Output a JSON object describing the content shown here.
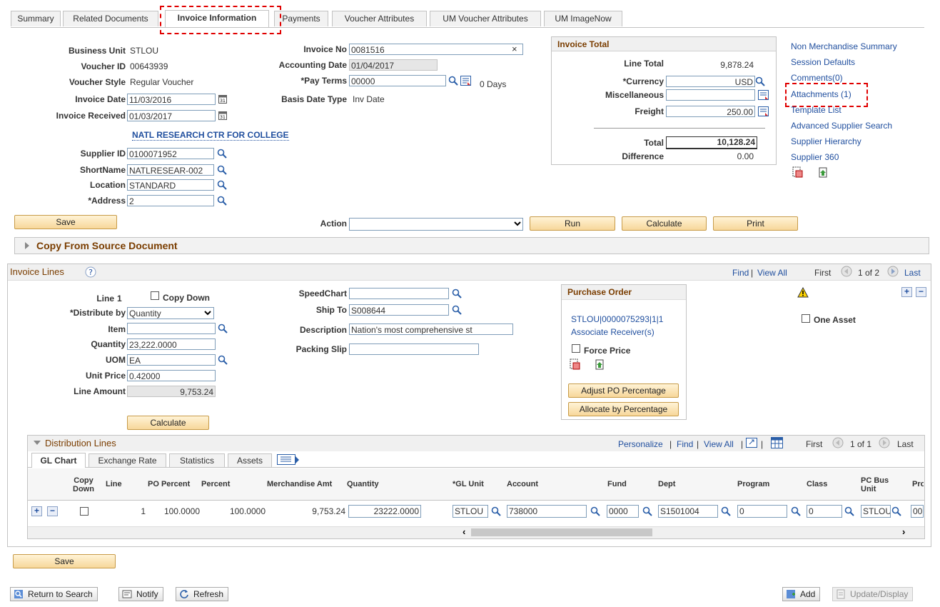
{
  "tabs": [
    "Summary",
    "Related Documents",
    "Invoice Information",
    "Payments",
    "Voucher Attributes",
    "UM Voucher Attributes",
    "UM ImageNow"
  ],
  "header": {
    "business_unit_label": "Business Unit",
    "business_unit": "STLOU",
    "voucher_id_label": "Voucher ID",
    "voucher_id": "00643939",
    "voucher_style_label": "Voucher Style",
    "voucher_style": "Regular Voucher",
    "invoice_date_label": "Invoice Date",
    "invoice_date": "11/03/2016",
    "invoice_received_label": "Invoice Received",
    "invoice_received": "01/03/2017",
    "supplier_name": "NATL RESEARCH CTR FOR COLLEGE",
    "supplier_id_label": "Supplier ID",
    "supplier_id": "0100071952",
    "shortname_label": "ShortName",
    "shortname": "NATLRESEAR-002",
    "location_label": "Location",
    "location": "STANDARD",
    "address_label": "*Address",
    "address": "2",
    "invoice_no_label": "Invoice No",
    "invoice_no": "0081516",
    "accounting_date_label": "Accounting Date",
    "accounting_date": "01/04/2017",
    "pay_terms_label": "*Pay Terms",
    "pay_terms": "00000",
    "pay_terms_days": "0 Days",
    "basis_date_type_label": "Basis Date Type",
    "basis_date_type": "Inv Date"
  },
  "invoice_total": {
    "title": "Invoice Total",
    "line_total_label": "Line Total",
    "line_total": "9,878.24",
    "currency_label": "*Currency",
    "currency": "USD",
    "misc_label": "Miscellaneous",
    "misc": "",
    "freight_label": "Freight",
    "freight": "250.00",
    "total_label": "Total",
    "total": "10,128.24",
    "difference_label": "Difference",
    "difference": "0.00"
  },
  "side_links": [
    "Non Merchandise Summary",
    "Session Defaults",
    "Comments(0)",
    "Attachments (1)",
    "Template List",
    "Advanced Supplier Search",
    "Supplier Hierarchy",
    "Supplier 360"
  ],
  "actions": {
    "save": "Save",
    "action_label": "Action",
    "action_value": "",
    "run": "Run",
    "calculate": "Calculate",
    "print": "Print"
  },
  "copy_from": "Copy From Source Document",
  "invoice_lines": {
    "title": "Invoice Lines",
    "nav": {
      "find": "Find",
      "sep": "|",
      "view_all": "View All",
      "first": "First",
      "range": "1 of 2",
      "last": "Last"
    },
    "line_label": "Line",
    "line": "1",
    "copy_down": "Copy Down",
    "distribute_by_label": "*Distribute by",
    "distribute_by": "Quantity",
    "item_label": "Item",
    "item": "",
    "quantity_label": "Quantity",
    "quantity": "23,222.0000",
    "uom_label": "UOM",
    "uom": "EA",
    "unit_price_label": "Unit Price",
    "unit_price": "0.42000",
    "line_amount_label": "Line Amount",
    "line_amount": "9,753.24",
    "calculate": "Calculate",
    "speedchart_label": "SpeedChart",
    "speedchart": "",
    "ship_to_label": "Ship To",
    "ship_to": "S008644",
    "description_label": "Description",
    "description": "Nation's most comprehensive st",
    "packing_slip_label": "Packing Slip",
    "packing_slip": "",
    "po_title": "Purchase Order",
    "po_link": "STLOU|0000075293|1|1",
    "associate_receiver": "Associate Receiver(s)",
    "force_price": "Force Price",
    "adjust_po": "Adjust PO Percentage",
    "allocate": "Allocate by Percentage",
    "one_asset": "One Asset"
  },
  "distribution": {
    "title": "Distribution Lines",
    "nav": {
      "personalize": "Personalize",
      "sep": "|",
      "find": "Find",
      "view_all": "View All",
      "first": "First",
      "range": "1 of 1",
      "last": "Last"
    },
    "tabs": [
      "GL Chart",
      "Exchange Rate",
      "Statistics",
      "Assets"
    ],
    "columns": [
      "Copy Down",
      "Line",
      "PO Percent",
      "Percent",
      "Merchandise Amt",
      "Quantity",
      "*GL Unit",
      "Account",
      "Fund",
      "Dept",
      "Program",
      "Class",
      "PC Bus Unit",
      "Pro"
    ],
    "row": {
      "line": "1",
      "po_percent": "100.0000",
      "percent": "100.0000",
      "merch_amt": "9,753.24",
      "quantity": "23222.0000",
      "gl_unit": "STLOU",
      "account": "738000",
      "fund": "0000",
      "dept": "S1501004",
      "program": "0",
      "class": "0",
      "pc_bus_unit": "STLOU",
      "pro": "00"
    }
  },
  "footer": {
    "save": "Save",
    "return_to_search": "Return to Search",
    "notify": "Notify",
    "refresh": "Refresh",
    "add": "Add",
    "update_display": "Update/Display"
  }
}
